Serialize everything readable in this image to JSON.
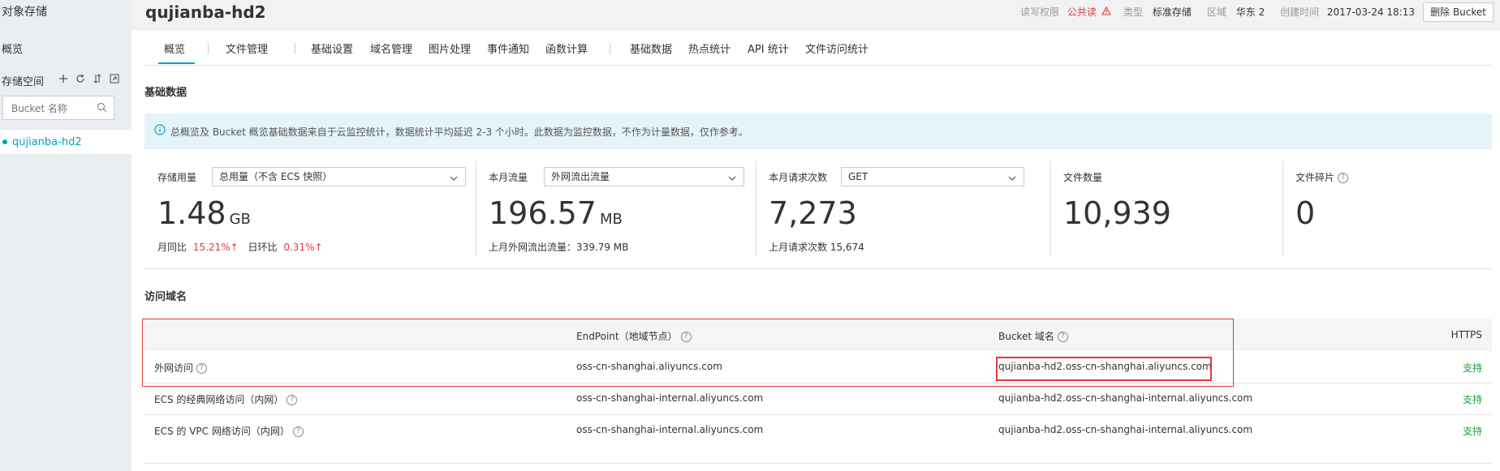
{
  "sidebar": {
    "title": "对象存储",
    "overview": "概览",
    "storage_label": "存储空间",
    "tools": [
      "add-icon",
      "refresh-icon",
      "sort-icon",
      "expand-icon"
    ],
    "search_placeholder": "Bucket 名称",
    "buckets": [
      "qujianba-hd2"
    ]
  },
  "header": {
    "title": "qujianba-hd2",
    "acl_label": "读写权限",
    "acl_value": "公共读",
    "type_label": "类型",
    "type_value": "标准存储",
    "region_label": "区域",
    "region_value": "华东 2",
    "created_label": "创建时间",
    "created_value": "2017-03-24 18:13",
    "delete_button": "删除 Bucket"
  },
  "tabs": [
    "概览",
    "文件管理",
    "基础设置",
    "域名管理",
    "图片处理",
    "事件通知",
    "函数计算",
    "基础数据",
    "热点统计",
    "API 统计",
    "文件访问统计"
  ],
  "active_tab": "概览",
  "basic_data": {
    "heading": "基础数据",
    "notice": "总概览及 Bucket 概览基础数据来自于云监控统计，数据统计平均延迟 2-3 个小时。此数据为监控数据，不作为计量数据，仅作参考。",
    "stats": [
      {
        "label": "存储用量",
        "select": "总用量（不含 ECS 快照）",
        "value": "1.48",
        "unit": "GB",
        "sub_a_label": "月同比",
        "sub_a_value": "15.21%",
        "sub_b_label": "日环比",
        "sub_b_value": "0.31%"
      },
      {
        "label": "本月流量",
        "select": "外网流出流量",
        "value": "196.57",
        "unit": "MB",
        "sub": "上月外网流出流量：339.79 MB"
      },
      {
        "label": "本月请求次数",
        "select": "GET",
        "value": "7,273",
        "unit": "",
        "sub": "上月请求次数 15,674"
      },
      {
        "label": "文件数量",
        "value": "10,939"
      },
      {
        "label": "文件碎片",
        "value": "0"
      }
    ]
  },
  "domains": {
    "heading": "访问域名",
    "columns": [
      "",
      "EndPoint（地域节点）",
      "Bucket 域名",
      "HTTPS"
    ],
    "rows": [
      {
        "name": "外网访问",
        "endpoint": "oss-cn-shanghai.aliyuncs.com",
        "bucket_domain": "qujianba-hd2.oss-cn-shanghai.aliyuncs.com",
        "https": "支持"
      },
      {
        "name": "ECS 的经典网络访问（内网）",
        "endpoint": "oss-cn-shanghai-internal.aliyuncs.com",
        "bucket_domain": "qujianba-hd2.oss-cn-shanghai-internal.aliyuncs.com",
        "https": "支持"
      },
      {
        "name": "ECS 的 VPC 网络访问（内网）",
        "endpoint": "oss-cn-shanghai-internal.aliyuncs.com",
        "bucket_domain": "qujianba-hd2.oss-cn-shanghai-internal.aliyuncs.com",
        "https": "支持"
      }
    ]
  }
}
